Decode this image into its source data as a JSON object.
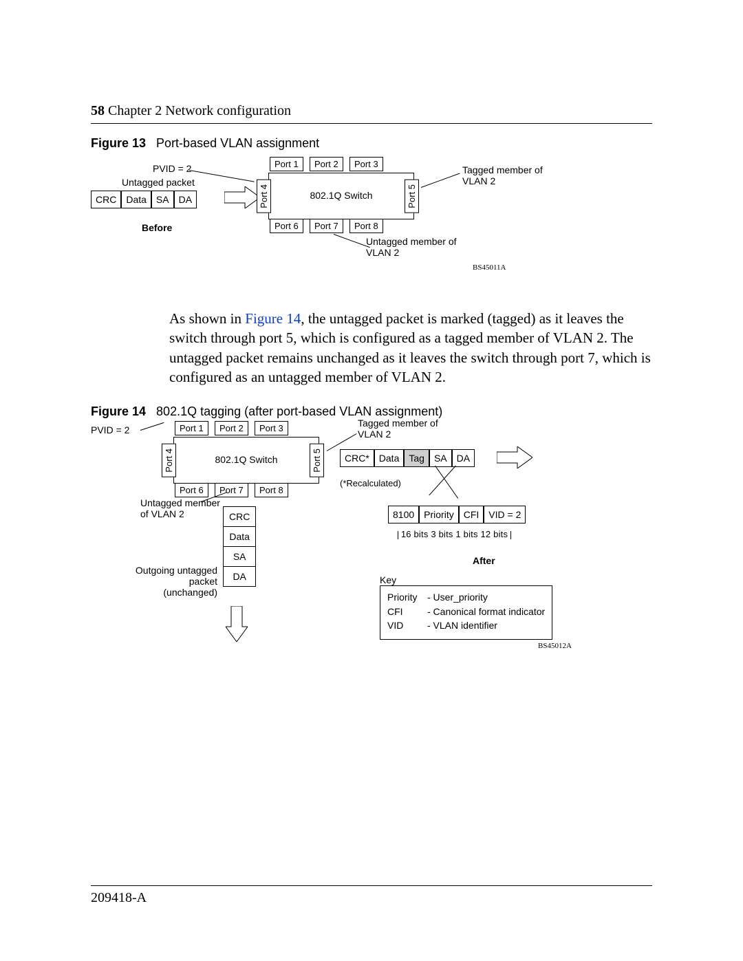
{
  "page": {
    "number": "58",
    "chapter": "Chapter 2  Network configuration",
    "doc_id": "209418-A"
  },
  "figure13": {
    "label": "Figure 13",
    "title": "Port-based VLAN assignment",
    "pvid": "PVID = 2",
    "untagged_packet": "Untagged packet",
    "before": "Before",
    "switch": "802.1Q Switch",
    "ports": {
      "p1": "Port 1",
      "p2": "Port 2",
      "p3": "Port 3",
      "p4": "Port 4",
      "p5": "Port 5",
      "p6": "Port 6",
      "p7": "Port 7",
      "p8": "Port 8"
    },
    "tagged_member": "Tagged member of VLAN 2",
    "untagged_member": "Untagged member of VLAN 2",
    "packet": {
      "crc": "CRC",
      "data": "Data",
      "sa": "SA",
      "da": "DA"
    },
    "ref": "BS45011A"
  },
  "paragraph": {
    "pre": "As shown in ",
    "link": "Figure 14",
    "post": ", the untagged packet is marked (tagged) as it leaves the switch through port 5, which is configured as a tagged member of VLAN 2. The untagged packet remains unchanged as it leaves the switch through port 7, which is configured as an untagged member of VLAN 2."
  },
  "figure14": {
    "label": "Figure 14",
    "title": "802.1Q tagging (after port-based VLAN assignment)",
    "pvid": "PVID = 2",
    "switch": "802.1Q Switch",
    "ports": {
      "p1": "Port 1",
      "p2": "Port 2",
      "p3": "Port 3",
      "p4": "Port 4",
      "p5": "Port 5",
      "p6": "Port 6",
      "p7": "Port 7",
      "p8": "Port 8"
    },
    "tagged_member": "Tagged member of VLAN 2",
    "untagged_member": "Untagged member of VLAN 2",
    "recalc": "(*Recalculated)",
    "packet_out": {
      "crc": "CRC*",
      "data": "Data",
      "tag": "Tag",
      "sa": "SA",
      "da": "DA"
    },
    "tag_fields": {
      "tpid": "8100",
      "prio": "Priority",
      "cfi": "CFI",
      "vid": "VID = 2"
    },
    "bits_row": "16 bits     3 bits   1 bits    12 bits",
    "after": "After",
    "vertical_packet": {
      "crc": "CRC",
      "data": "Data",
      "sa": "SA",
      "da": "DA"
    },
    "outgoing": "Outgoing untagged packet (unchanged)",
    "key_label": "Key",
    "key": {
      "prio_l": "Priority",
      "prio_r": "- User_priority",
      "cfi_l": "CFI",
      "cfi_r": "- Canonical format indicator",
      "vid_l": "VID",
      "vid_r": "- VLAN identifier"
    },
    "ref": "BS45012A"
  }
}
